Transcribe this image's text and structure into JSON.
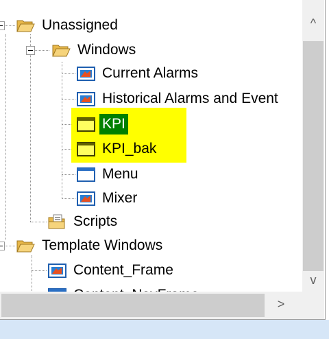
{
  "tree": {
    "nodes": [
      {
        "label": "Unassigned",
        "icon": "folder-open-icon"
      },
      {
        "label": "Windows",
        "icon": "folder-open-icon"
      },
      {
        "label": "Current Alarms",
        "icon": "window-graphic-icon"
      },
      {
        "label": "Historical Alarms and Event",
        "icon": "window-graphic-icon"
      },
      {
        "label": "KPI",
        "icon": "window-yellow-icon",
        "selected": true,
        "highlight": "#ffff00"
      },
      {
        "label": "KPI_bak",
        "icon": "window-yellow-icon",
        "highlight": "#ffff00"
      },
      {
        "label": "Menu",
        "icon": "window-blue-icon"
      },
      {
        "label": "Mixer",
        "icon": "window-graphic-icon"
      },
      {
        "label": "Scripts",
        "icon": "scripts-folder-icon"
      },
      {
        "label": "Template Windows",
        "icon": "folder-open-icon"
      },
      {
        "label": "Content_Frame",
        "icon": "window-graphic-icon"
      },
      {
        "label": "Content_NavFrame",
        "icon": "window-blue-icon"
      }
    ]
  },
  "scrollbar": {
    "up_arrow": "^",
    "down_arrow": "v",
    "right_arrow": ">"
  },
  "colors": {
    "highlight": "#ffff00",
    "selection": "#008000",
    "folder": "#f0c050"
  }
}
